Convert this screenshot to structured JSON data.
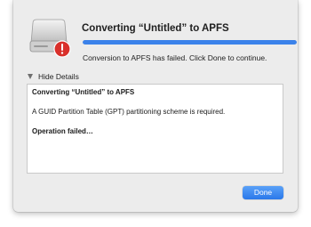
{
  "dialog": {
    "title": "Converting “Untitled” to APFS",
    "progress_percent": 100,
    "status_message": "Conversion to APFS has failed. Click Done to continue.",
    "details_toggle_label": "Hide Details",
    "log": {
      "line1": "Converting “Untitled” to APFS",
      "line2": "A GUID Partition Table (GPT) partitioning scheme is required.",
      "line3": "Operation failed…"
    },
    "done_label": "Done",
    "icons": {
      "disk": "hard-disk-icon",
      "badge": "error-badge-icon",
      "toggle": "disclosure-triangle-icon"
    },
    "colors": {
      "accent": "#3b82ea",
      "error_badge": "#d9302b"
    }
  }
}
